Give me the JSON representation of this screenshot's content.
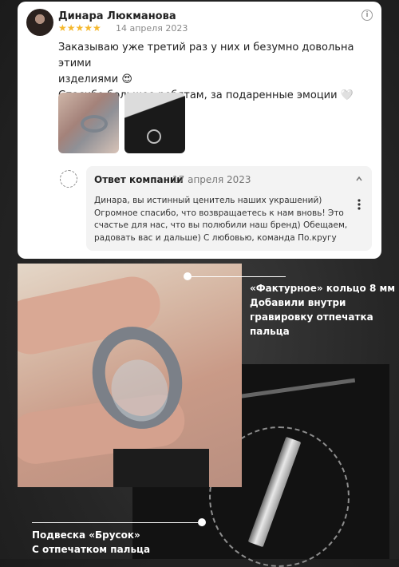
{
  "review": {
    "author": "Динара Люкманова",
    "rating": 5,
    "stars": "★★★★★",
    "date": "14 апреля 2023",
    "text_line1": "Заказываю уже третий раз у них и безумно довольна этими",
    "text_line2": "изделиями 😍",
    "text_line3": "Спасибо большое ребятам, за подаренные эмоции 🤍",
    "icons": {
      "info": "info-icon",
      "star": "star-icon"
    }
  },
  "reply": {
    "title": "Ответ компании",
    "date": "17 апреля 2023",
    "text": "Динара, вы истинный ценитель наших украшений) Огромное спасибо, что возвращаетесь к нам вновь! Это счастье для нас, что вы полюбили наш бренд) Обещаем, радовать вас и дальше) С любовью, команда По.кругу",
    "icons": {
      "collapse": "chevron-up-icon",
      "menu": "more-vertical-icon"
    }
  },
  "annotations": {
    "ring_line1": "«Фактурное» кольцо 8 мм",
    "ring_line2": "Добавили внутри",
    "ring_line3": "гравировку отпечатка",
    "ring_line4": "пальца",
    "pendant_line1": "Подвеска «Брусок»",
    "pendant_line2": "С отпечатком пальца"
  },
  "colors": {
    "background": "#262626",
    "card": "#ffffff",
    "star": "#f5b82e",
    "reply_bg": "#f3f3f3",
    "caption": "#ffffff"
  }
}
